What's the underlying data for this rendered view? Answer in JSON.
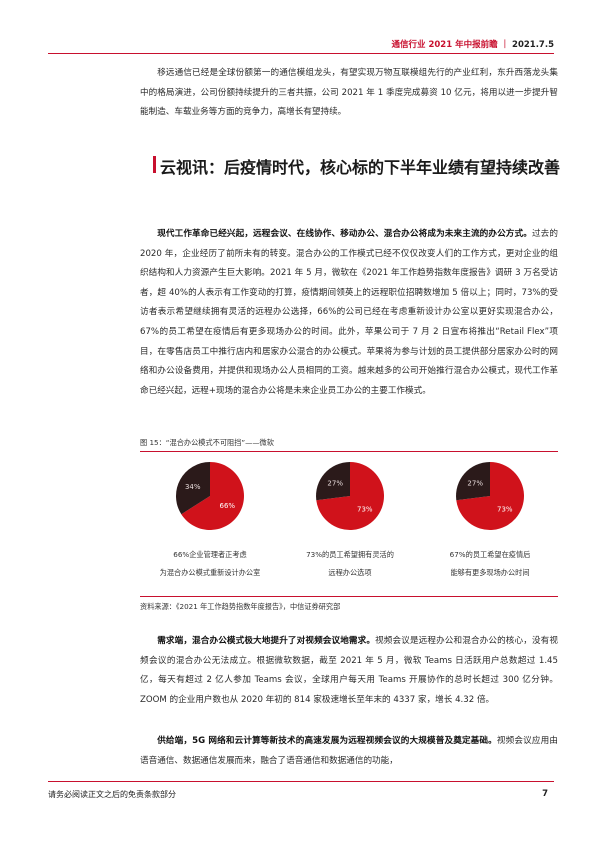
{
  "header": {
    "title": "通信行业 2021 年中报前瞻",
    "separator": "｜",
    "date": "2021.7.5"
  },
  "intro_paragraph": "移远通信已经是全球份额第一的通信模组龙头，有望实现万物互联模组先行的产业红利，东升西落龙头集中的格局演进，公司份额持续提升的三者共振，公司 2021 年 1 季度完成募资 10 亿元，将用以进一步提升智能制造、车载业务等方面的竞争力，高增长有望持续。",
  "section_title": "云视讯：后疫情时代，核心标的下半年业绩有望持续改善",
  "para1": {
    "lead": "现代工作革命已经兴起，远程会议、在线协作、移动办公、混合办公将成为未来主流的办公方式。",
    "body": "过去的 2020 年，企业经历了前所未有的转变。混合办公的工作模式已经不仅仅改变人们的工作方式，更对企业的组织结构和人力资源产生巨大影响。2021 年 5 月，微软在《2021 年工作趋势指数年度报告》调研 3 万名受访者，超 40%的人表示有工作变动的打算，疫情期间领英上的远程职位招聘数增加 5 倍以上；同时，73%的受访者表示希望继续拥有灵活的远程办公选择，66%的公司已经在考虑重新设计办公室以更好实现混合办公，67%的员工希望在疫情后有更多现场办公的时间。此外，苹果公司于 7 月 2 日宣布将推出“Retail Flex”项目，在零售店员工中推行店内和居家办公混合的办公模式。苹果将为参与计划的员工提供部分居家办公时的网络和办公设备费用，并提供和现场办公人员相同的工资。越来越多的公司开始推行混合办公模式，现代工作革命已经兴起，远程+现场的混合办公将是未来企业员工办公的主要工作模式。"
  },
  "figure": {
    "caption": "图 15：“混合办公模式不可阻挡”——微软",
    "source": "资料来源：《2021 年工作趋势指数年度报告》，中信证券研究部",
    "colors": {
      "primary": "#d0121b",
      "secondary": "#2b1a1a"
    }
  },
  "chart_data": [
    {
      "type": "pie",
      "title": "66%企业管理者正考虑为混合办公模式重新设计办公室",
      "caption_lines": [
        "66%企业管理者正考虑",
        "为混合办公模式重新设计办公室"
      ],
      "slices": [
        {
          "label": "66%",
          "value": 66,
          "color": "#d0121b"
        },
        {
          "label": "34%",
          "value": 34,
          "color": "#2b1a1a"
        }
      ]
    },
    {
      "type": "pie",
      "title": "73%的员工希望拥有灵活的远程办公选项",
      "caption_lines": [
        "73%的员工希望拥有灵活的",
        "远程办公选项"
      ],
      "slices": [
        {
          "label": "73%",
          "value": 73,
          "color": "#d0121b"
        },
        {
          "label": "27%",
          "value": 27,
          "color": "#2b1a1a"
        }
      ]
    },
    {
      "type": "pie",
      "title": "67%的员工希望在疫情后能够有更多现场办公时间",
      "caption_lines": [
        "67%的员工希望在疫情后",
        "能够有更多现场办公时间"
      ],
      "slices": [
        {
          "label": "73%",
          "value": 73,
          "color": "#d0121b"
        },
        {
          "label": "27%",
          "value": 27,
          "color": "#2b1a1a"
        }
      ]
    }
  ],
  "para2": {
    "lead": "需求端，混合办公模式极大地提升了对视频会议地需求。",
    "body": "视频会议是远程办公和混合办公的核心，没有视频会议的混合办公无法成立。根据微软数据，截至 2021 年 5 月，微软 Teams 日活跃用户总数超过 1.45 亿，每天有超过 2 亿人参加 Teams 会议，全球用户每天用 Teams 开展协作的总时长超过 300 亿分钟。ZOOM 的企业用户数也从 2020 年初的 814 家极速增长至年末的 4337 家，增长 4.32 倍。"
  },
  "para3": {
    "lead": "供给端，5G 网络和云计算等新技术的高速发展为远程视频会议的大规模普及奠定基础。",
    "body": "视频会议应用由语音通信、数据通信发展而来，融合了语音通信和数据通信的功能，"
  },
  "footer": {
    "disclaimer": "请务必阅读正文之后的免责条款部分",
    "page": "7"
  }
}
